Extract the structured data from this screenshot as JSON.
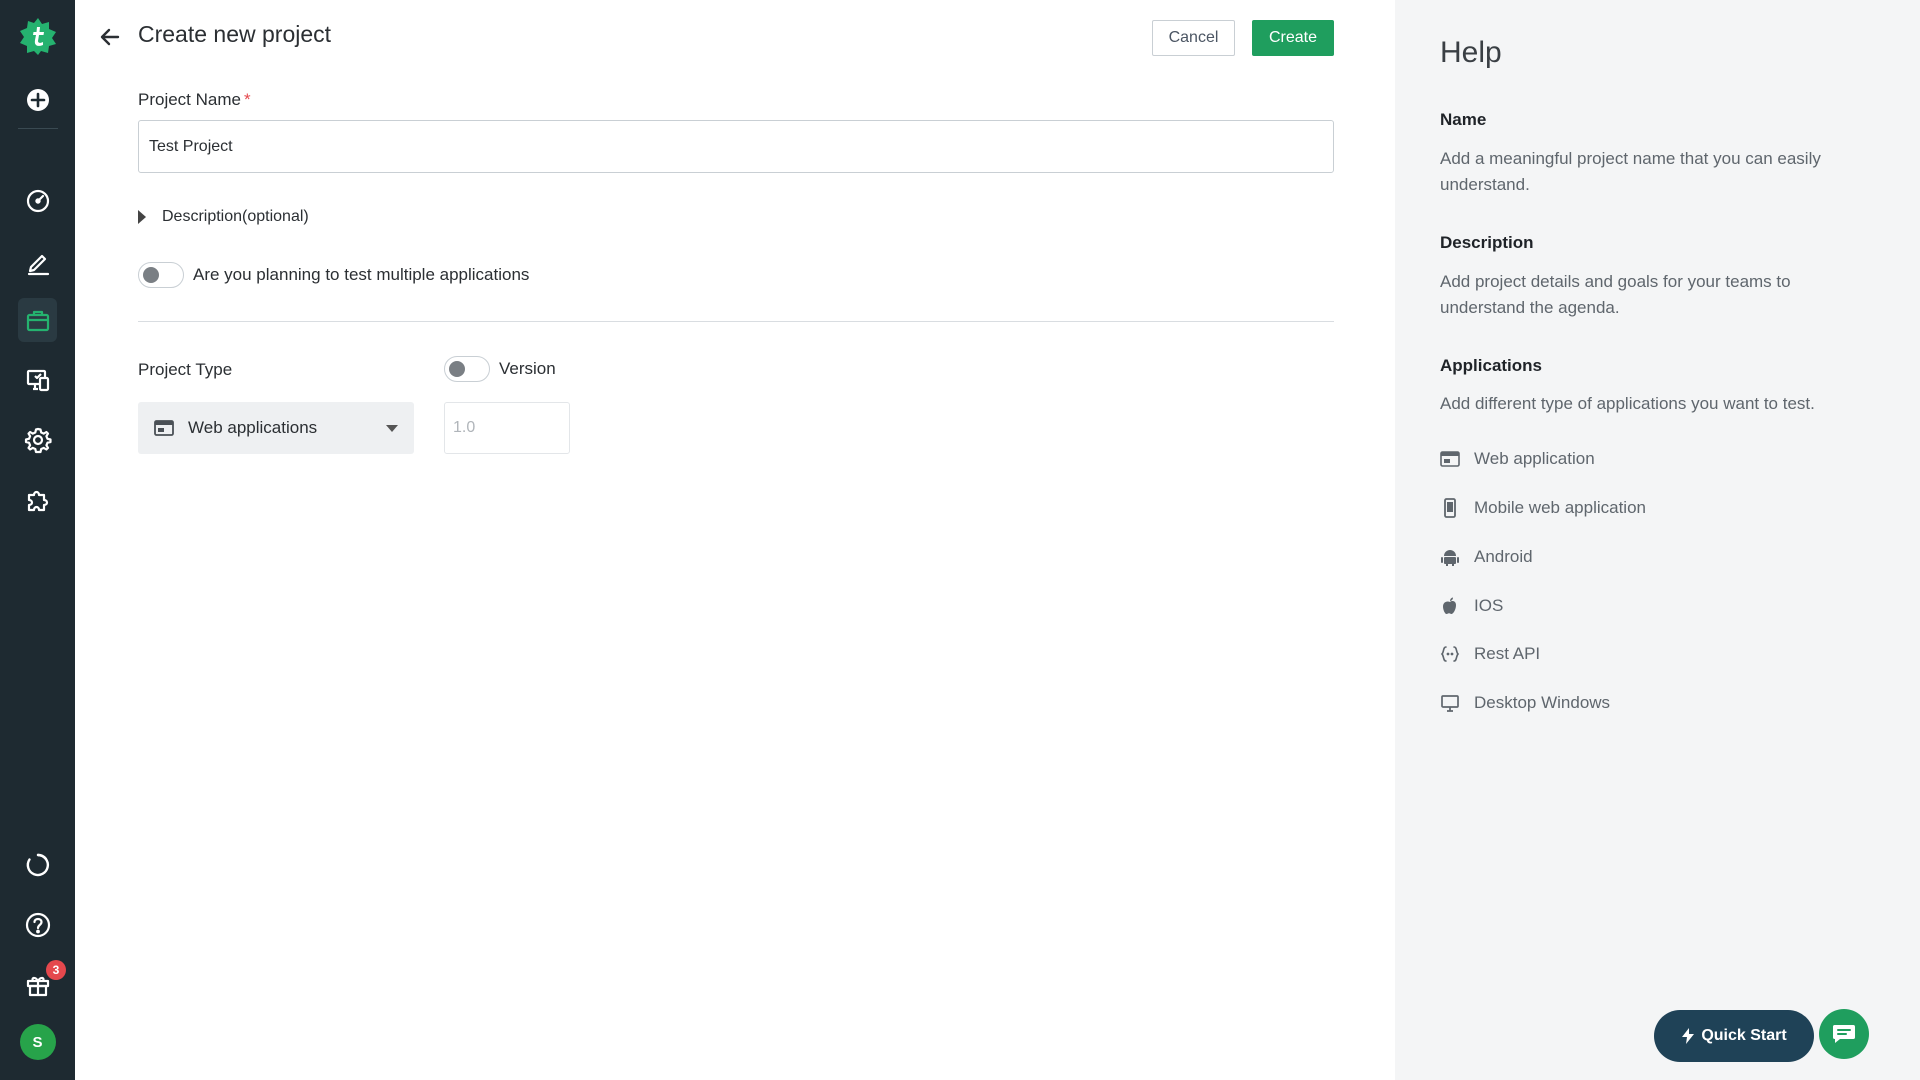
{
  "sidebar": {
    "logo_icon": "testsigma-logo-icon",
    "items": [
      {
        "name": "add",
        "icon": "plus-circle-icon"
      },
      {
        "name": "dashboard",
        "icon": "speedometer-icon"
      },
      {
        "name": "test-development",
        "icon": "pencil-icon"
      },
      {
        "name": "projects",
        "icon": "briefcase-icon",
        "active": true
      },
      {
        "name": "agents",
        "icon": "device-icon"
      },
      {
        "name": "settings",
        "icon": "gear-icon"
      },
      {
        "name": "addons",
        "icon": "puzzle-icon"
      }
    ],
    "bottom": {
      "sync_icon": "sync-icon",
      "help_icon": "question-icon",
      "gift_icon": "gift-icon",
      "gift_badge": "3",
      "avatar_letter": "S"
    }
  },
  "header": {
    "title": "Create new project",
    "cancel_label": "Cancel",
    "create_label": "Create"
  },
  "form": {
    "name_label": "Project Name",
    "required_mark": "*",
    "name_value": "Test Project",
    "description_toggle": "Description(optional)",
    "multi_app_label": "Are you planning to test multiple applications",
    "multi_app_on": false,
    "project_type_label": "Project Type",
    "version_toggle_label": "Version",
    "version_on": false,
    "project_type_value": "Web applications",
    "version_placeholder": "1.0"
  },
  "help": {
    "title": "Help",
    "sections": [
      {
        "heading": "Name",
        "text": "Add a meaningful project name that you can easily understand."
      },
      {
        "heading": "Description",
        "text": "Add project details and goals for your teams to understand the agenda."
      },
      {
        "heading": "Applications",
        "text": "Add different type of applications you want to test."
      }
    ],
    "applications": [
      {
        "label": "Web application",
        "icon": "browser-window-icon"
      },
      {
        "label": "Mobile web application",
        "icon": "mobile-phone-icon"
      },
      {
        "label": "Android",
        "icon": "android-icon"
      },
      {
        "label": "IOS",
        "icon": "apple-icon"
      },
      {
        "label": "Rest API",
        "icon": "api-braces-icon"
      },
      {
        "label": "Desktop Windows",
        "icon": "monitor-icon"
      }
    ]
  },
  "floating": {
    "quick_start_label": "Quick Start",
    "chat_icon": "chat-icon"
  },
  "colors": {
    "sidebar_bg": "#1e2a31",
    "accent_green": "#1f9e5e",
    "quick_start_bg": "#1f4257",
    "help_bg": "#f4f5f6",
    "required_red": "#e5484d"
  }
}
